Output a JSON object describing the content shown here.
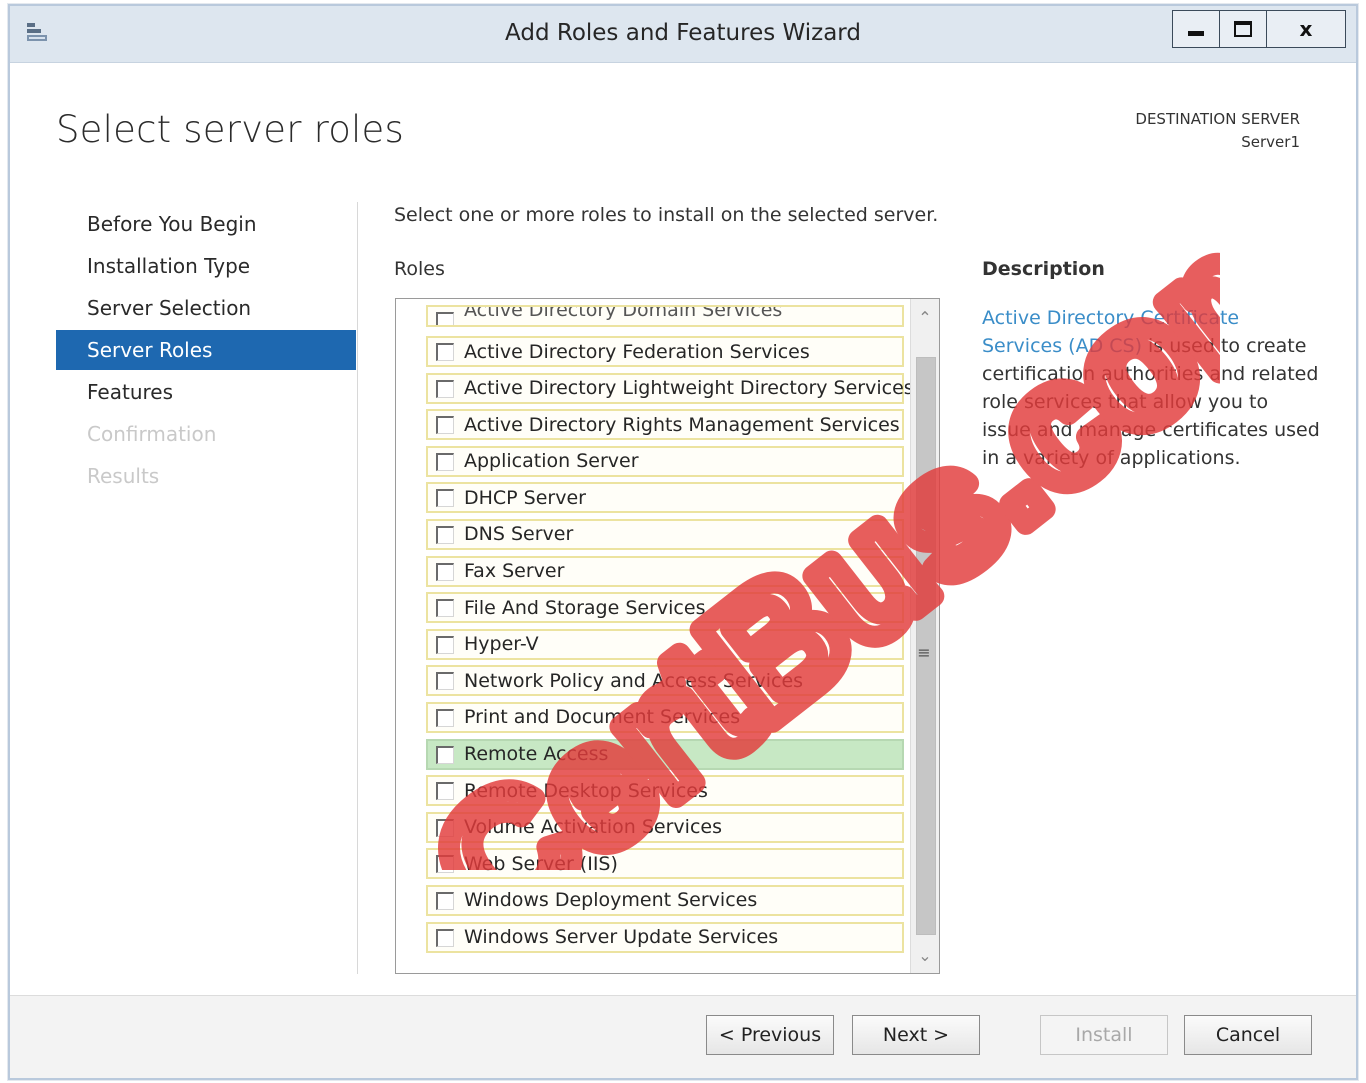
{
  "window": {
    "title": "Add Roles and Features Wizard",
    "close_glyph": "x"
  },
  "header": {
    "page_title": "Select server roles",
    "destination_label": "DESTINATION SERVER",
    "destination_server": "Server1"
  },
  "nav": {
    "items": [
      {
        "label": "Before You Begin",
        "state": "normal"
      },
      {
        "label": "Installation Type",
        "state": "normal"
      },
      {
        "label": "Server Selection",
        "state": "normal"
      },
      {
        "label": "Server Roles",
        "state": "active"
      },
      {
        "label": "Features",
        "state": "normal"
      },
      {
        "label": "Confirmation",
        "state": "disabled"
      },
      {
        "label": "Results",
        "state": "disabled"
      }
    ]
  },
  "main": {
    "instruction": "Select one or more roles to install on the selected server.",
    "roles_label": "Roles",
    "roles": [
      {
        "label": "Active Directory Domain Services",
        "checked": false
      },
      {
        "label": "Active Directory Federation Services",
        "checked": false
      },
      {
        "label": "Active Directory Lightweight Directory Services",
        "checked": false
      },
      {
        "label": "Active Directory Rights Management Services",
        "checked": false
      },
      {
        "label": "Application Server",
        "checked": false
      },
      {
        "label": "DHCP Server",
        "checked": false
      },
      {
        "label": "DNS Server",
        "checked": false
      },
      {
        "label": "Fax Server",
        "checked": false
      },
      {
        "label": "File And Storage Services",
        "checked": false
      },
      {
        "label": "Hyper-V",
        "checked": false
      },
      {
        "label": "Network Policy and Access Services",
        "checked": false
      },
      {
        "label": "Print and Document Services",
        "checked": false
      },
      {
        "label": "Remote Access",
        "checked": false,
        "highlighted": true
      },
      {
        "label": "Remote Desktop Services",
        "checked": false
      },
      {
        "label": "Volume Activation Services",
        "checked": false
      },
      {
        "label": "Web Server (IIS)",
        "checked": false
      },
      {
        "label": "Windows Deployment Services",
        "checked": false
      },
      {
        "label": "Windows Server Update Services",
        "checked": false
      }
    ]
  },
  "description": {
    "heading": "Description",
    "link_text": "Active Directory Certificate Services (AD CS)",
    "body": " is used to create certification authorities and related role services that allow you to issue and manage certificates used in a variety of applications."
  },
  "footer": {
    "previous": "< Previous",
    "next": "Next >",
    "install": "Install",
    "cancel": "Cancel"
  },
  "watermark": {
    "text": "CertBus.com",
    "color": "#e23b3b"
  },
  "colors": {
    "accent": "#1e68b0",
    "highlight_row": "#c7e8c4",
    "link": "#3a8dc8"
  }
}
